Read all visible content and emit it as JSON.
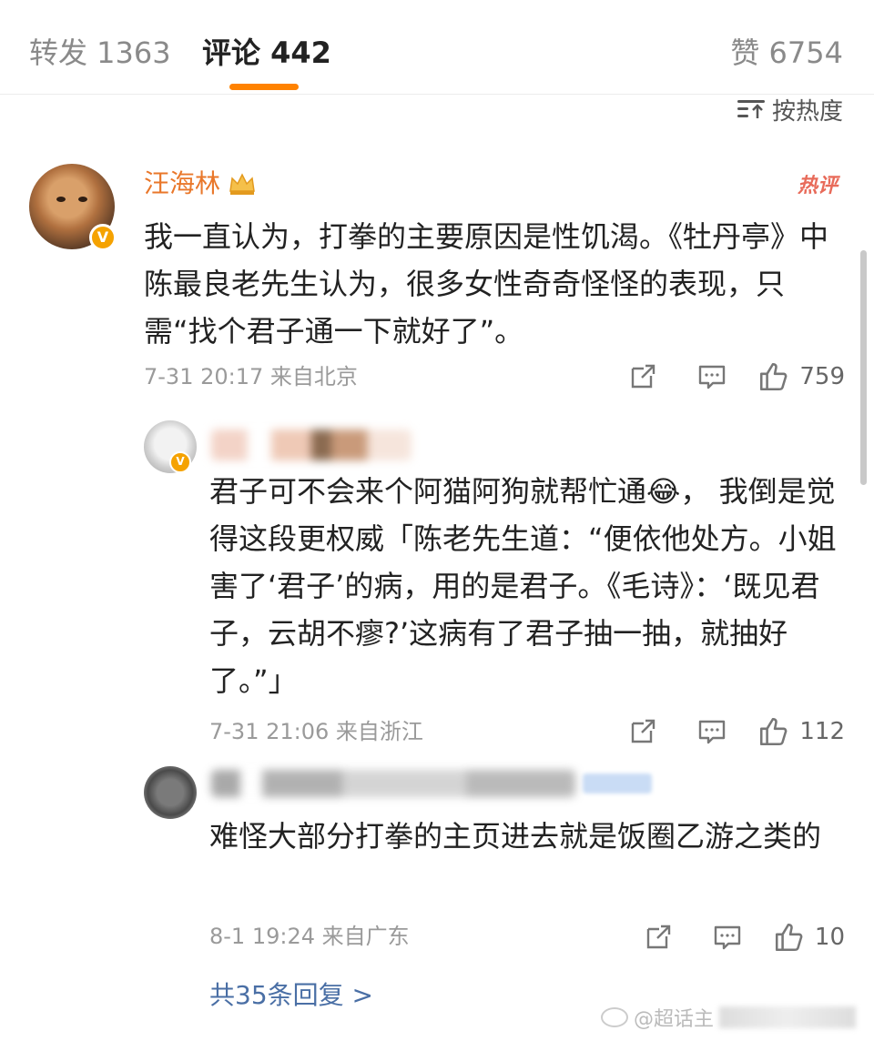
{
  "tabs": {
    "repost": "转发 1363",
    "comment": "评论 442",
    "like": "赞 6754"
  },
  "sort": {
    "label": "按热度"
  },
  "main_comment": {
    "username": "汪海林",
    "hot_tag": "热评",
    "badge": "V",
    "text": "我一直认为，打拳的主要原因是性饥渴。《牡丹亭》中陈最良老先生认为，很多女性奇奇怪怪的表现，只需“找个君子通一下就好了”。",
    "time": "7-31 20:17",
    "source": "来自北京",
    "likes": "759"
  },
  "replies": [
    {
      "badge": "V",
      "text": "君子可不会来个阿猫阿狗就帮忙通😂， 我倒是觉得这段更权威「陈老先生道：“便依他处方。小姐害了‘君子’的病，用的是君子。《毛诗》：‘既见君子，云胡不瘳?’这病有了君子抽一抽，就抽好了。”」",
      "time": "7-31 21:06",
      "source": "来自浙江",
      "likes": "112"
    },
    {
      "text": "难怪大部分打拳的主页进去就是饭圈乙游之类的",
      "time": "8-1 19:24",
      "source": "来自广东",
      "likes": "10"
    }
  ],
  "more_replies": "共35条回复 >",
  "watermark": "@超话主",
  "icons": {
    "share": "share-icon",
    "comment": "comment-icon",
    "like": "thumbs-up-icon",
    "sort": "sort-icon",
    "crown": "crown-icon"
  },
  "colors": {
    "accent": "#ff8200",
    "username": "#e9772a",
    "hot": "#e86b5a",
    "link": "#4a6fa5",
    "muted": "#9a9a9a"
  }
}
